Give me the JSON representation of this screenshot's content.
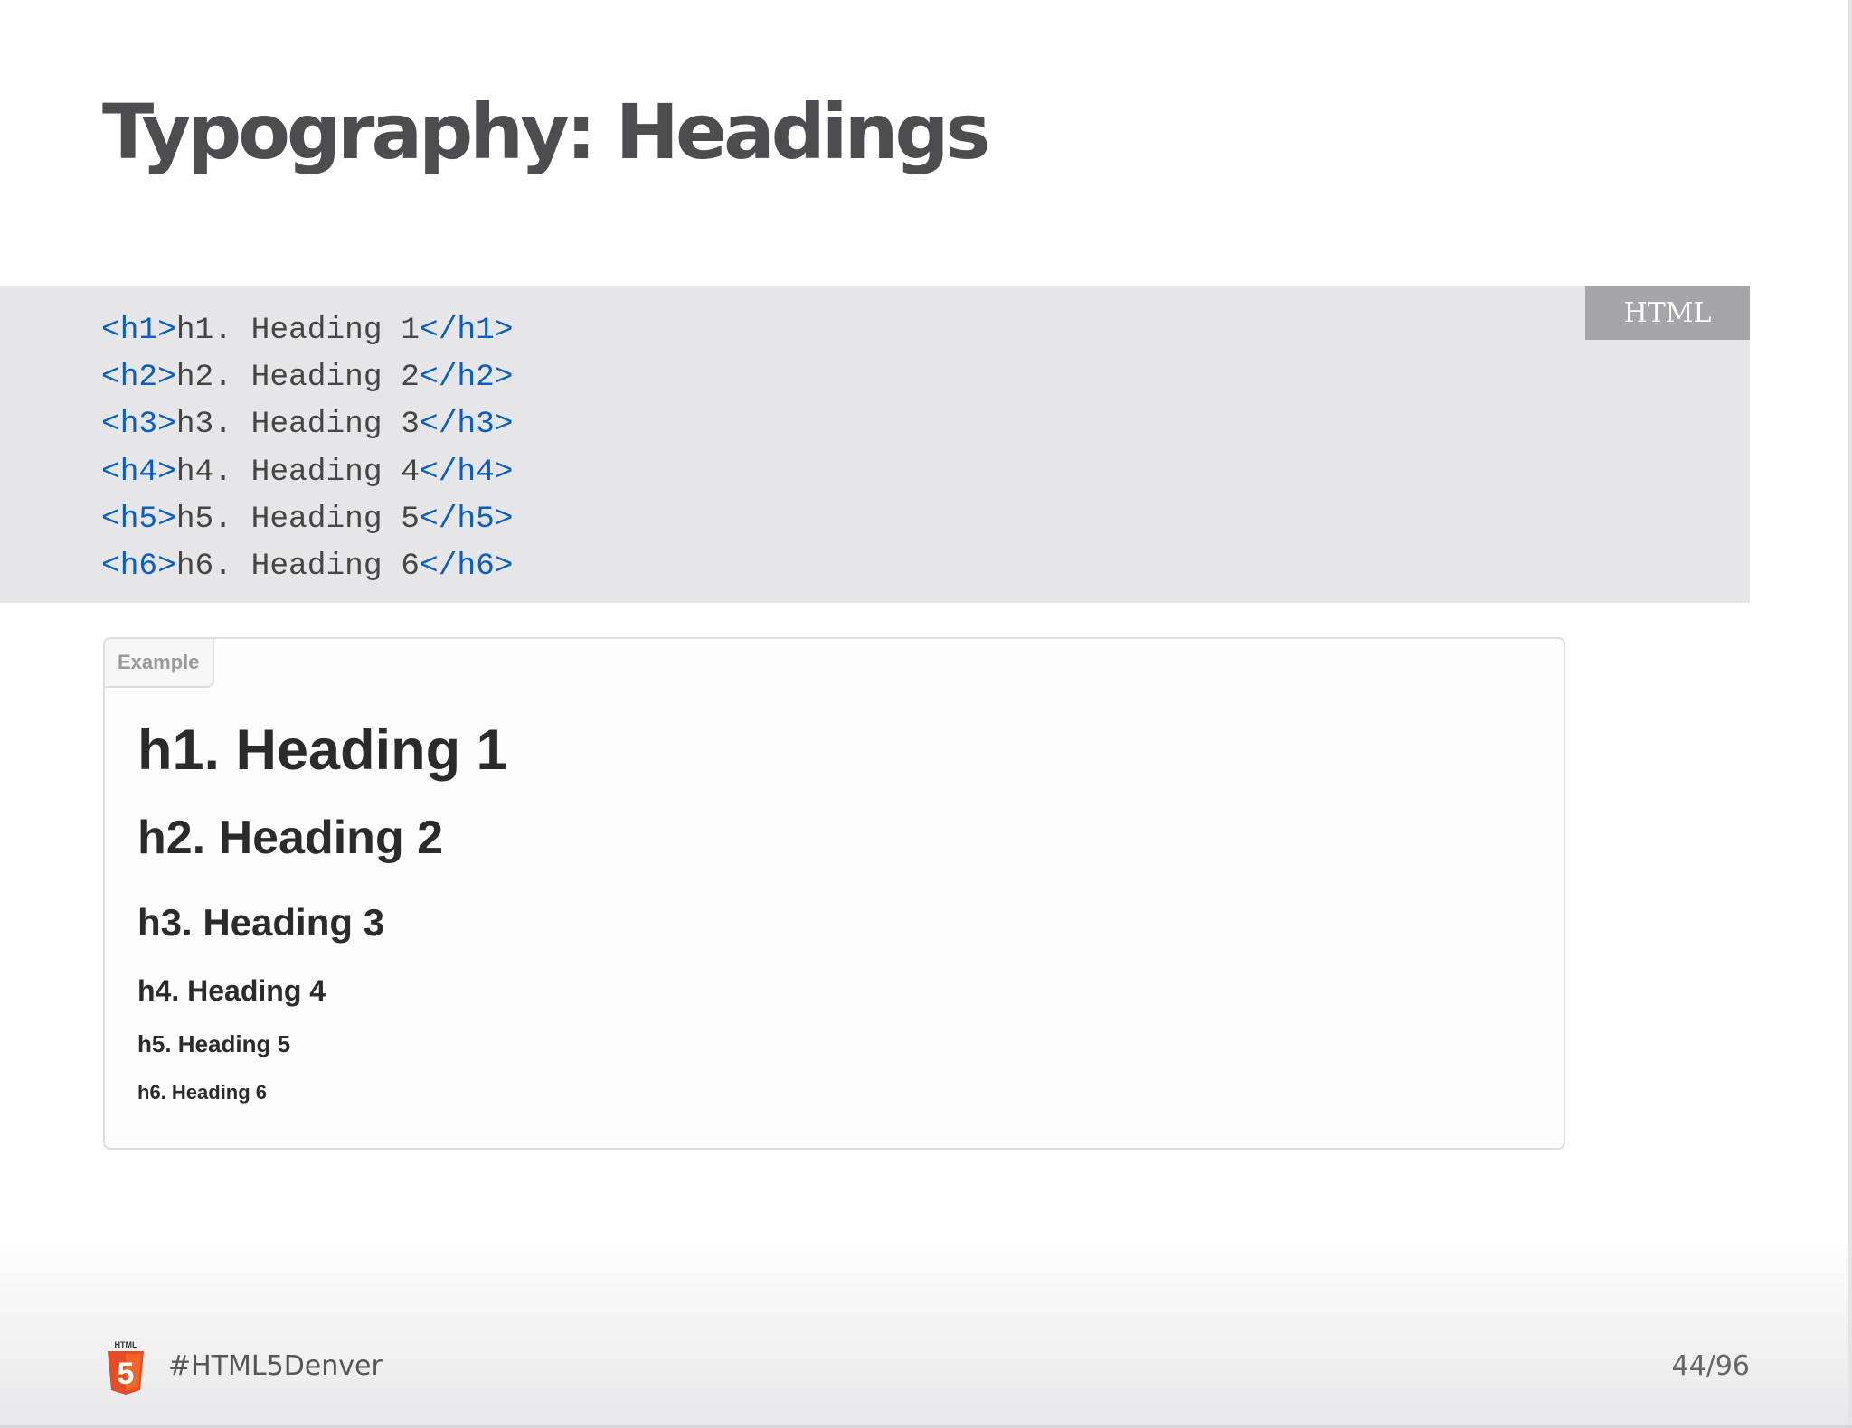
{
  "slide": {
    "title": "Typography: Headings"
  },
  "code": {
    "language_label": "HTML",
    "lines": [
      {
        "open": "<h1>",
        "text": "h1. Heading 1",
        "close": "</h1>"
      },
      {
        "open": "<h2>",
        "text": "h2. Heading 2",
        "close": "</h2>"
      },
      {
        "open": "<h3>",
        "text": "h3. Heading 3",
        "close": "</h3>"
      },
      {
        "open": "<h4>",
        "text": "h4. Heading 4",
        "close": "</h4>"
      },
      {
        "open": "<h5>",
        "text": "h5. Heading 5",
        "close": "</h5>"
      },
      {
        "open": "<h6>",
        "text": "h6. Heading 6",
        "close": "</h6>"
      }
    ]
  },
  "example": {
    "label": "Example",
    "headings": [
      "h1. Heading 1",
      "h2. Heading 2",
      "h3. Heading 3",
      "h4. Heading 4",
      "h5. Heading 5",
      "h6. Heading 6"
    ]
  },
  "footer": {
    "logo_icon": "html5-logo-icon",
    "logo_text": "HTML",
    "logo_number": "5",
    "hashtag": "#HTML5Denver",
    "page_number": "44/96"
  },
  "colors": {
    "code_background": "#e6e6e8",
    "tag_color": "#0a5ec0",
    "code_text": "#454545",
    "lang_badge": "#a6a6a8",
    "html5_orange": "#e44d26",
    "title_color": "#4d4d4f"
  }
}
